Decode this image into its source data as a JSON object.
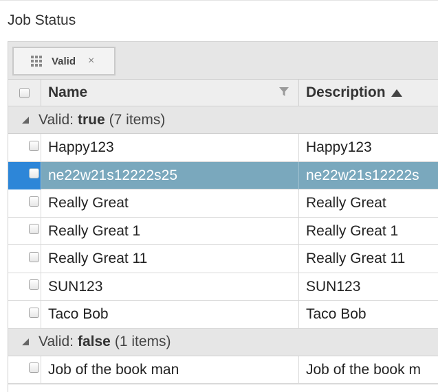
{
  "page": {
    "title": "Job Status"
  },
  "group_panel": {
    "chip_label": "Valid",
    "chip_close": "×"
  },
  "columns": {
    "name": "Name",
    "description": "Description"
  },
  "groups": [
    {
      "label": "Valid:",
      "value": "true",
      "count_text": "(7 items)",
      "rows": [
        {
          "name": "Happy123",
          "description": "Happy123",
          "selected": false
        },
        {
          "name": "ne22w21s12222s25",
          "description": "ne22w21s12222s",
          "selected": true
        },
        {
          "name": "Really Great",
          "description": "Really Great",
          "selected": false
        },
        {
          "name": "Really Great 1",
          "description": "Really Great 1",
          "selected": false
        },
        {
          "name": "Really Great 11",
          "description": "Really Great 11",
          "selected": false
        },
        {
          "name": "SUN123",
          "description": "SUN123",
          "selected": false
        },
        {
          "name": "Taco Bob",
          "description": "Taco Bob",
          "selected": false
        }
      ]
    },
    {
      "label": "Valid:",
      "value": "false",
      "count_text": "(1 items)",
      "rows": [
        {
          "name": "Job of the book man",
          "description": "Job of the book m",
          "selected": false
        }
      ]
    }
  ],
  "icons": {
    "group_chip": "grid-dots-icon",
    "filter": "filter-icon",
    "sort": "sort-ascending-icon",
    "expand": "expanded-caret-icon"
  },
  "colors": {
    "selected_row": "#7aa8bd",
    "selected_check_cell": "#2d86d8",
    "group_bg": "#e6e6e6"
  }
}
